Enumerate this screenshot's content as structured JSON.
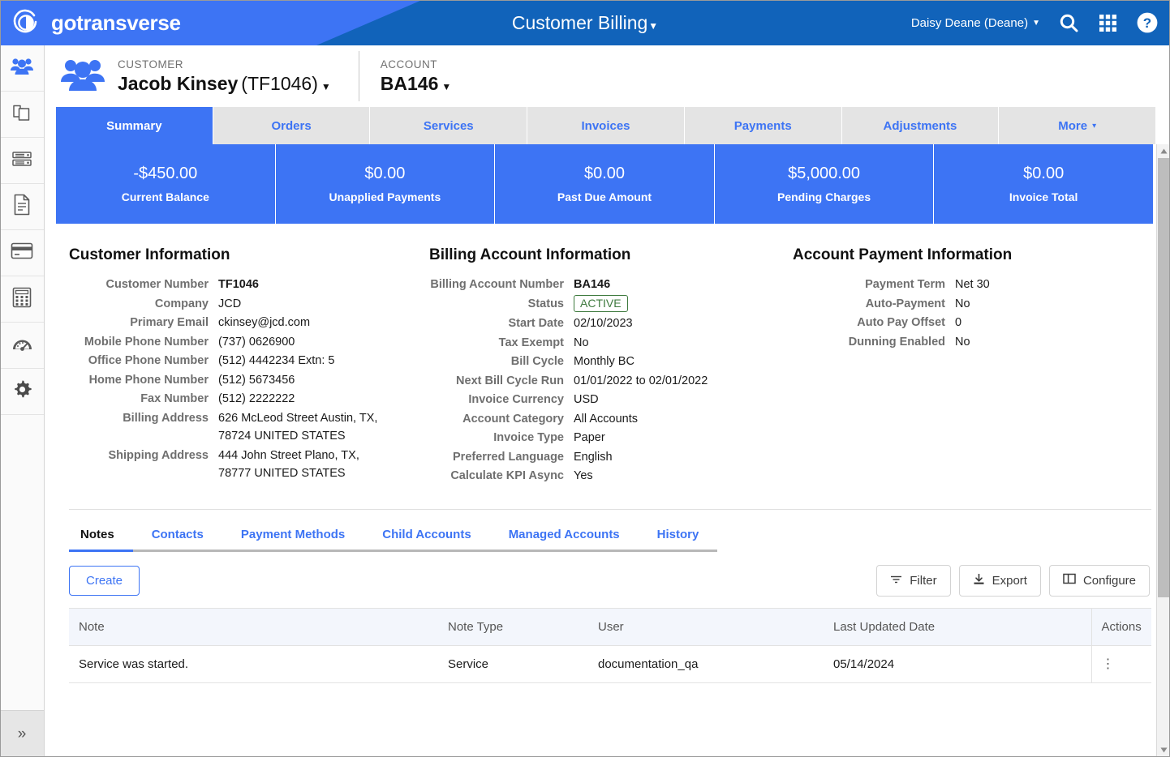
{
  "topbar": {
    "brand": "gotransverse",
    "logo_icon": "circular-arrow-logo-icon",
    "title": "Customer Billing",
    "title_caret": "▼",
    "user": "Daisy Deane (Deane)",
    "user_caret": "▼",
    "search_icon": "search-icon",
    "apps_icon": "apps-grid-icon",
    "help_icon": "help-circle-icon",
    "accent_blue": "#1163ba",
    "wedge_blue": "#3d74f4"
  },
  "rail": {
    "items": [
      {
        "icon": "customers-people-icon",
        "active": true
      },
      {
        "icon": "products-copy-icon",
        "active": false
      },
      {
        "icon": "servers-database-icon",
        "active": false
      },
      {
        "icon": "invoice-document-icon",
        "active": false
      },
      {
        "icon": "payments-credit-card-icon",
        "active": false
      },
      {
        "icon": "calculator-icon",
        "active": false
      },
      {
        "icon": "dashboard-gauge-icon",
        "active": false
      },
      {
        "icon": "settings-gear-icon",
        "active": false
      }
    ],
    "expand_icon": "»"
  },
  "context": {
    "people_icon": "customer-group-icon",
    "customer_label": "CUSTOMER",
    "customer_name": "Jacob Kinsey",
    "customer_number": "(TF1046)",
    "account_label": "ACCOUNT",
    "account_value": "BA146",
    "caret": "▼"
  },
  "tabs": [
    {
      "label": "Summary",
      "active": true
    },
    {
      "label": "Orders",
      "active": false
    },
    {
      "label": "Services",
      "active": false
    },
    {
      "label": "Invoices",
      "active": false
    },
    {
      "label": "Payments",
      "active": false
    },
    {
      "label": "Adjustments",
      "active": false
    },
    {
      "label": "More",
      "active": false,
      "caret": "▾"
    }
  ],
  "kpis": [
    {
      "value": "-$450.00",
      "label": "Current Balance"
    },
    {
      "value": "$0.00",
      "label": "Unapplied Payments"
    },
    {
      "value": "$0.00",
      "label": "Past Due Amount"
    },
    {
      "value": "$5,000.00",
      "label": "Pending Charges"
    },
    {
      "value": "$0.00",
      "label": "Invoice Total"
    }
  ],
  "customer_information": {
    "title": "Customer Information",
    "rows": [
      {
        "label": "Customer Number",
        "value": "TF1046",
        "bold": true
      },
      {
        "label": "Company",
        "value": "JCD"
      },
      {
        "label": "Primary Email",
        "value": "ckinsey@jcd.com"
      },
      {
        "label": "Mobile Phone Number",
        "value": "(737) 0626900"
      },
      {
        "label": "Office Phone Number",
        "value": "(512) 4442234 Extn: 5"
      },
      {
        "label": "Home Phone Number",
        "value": "(512) 5673456"
      },
      {
        "label": "Fax Number",
        "value": "(512) 2222222"
      },
      {
        "label": "Billing Address",
        "value": "626 McLeod Street Austin, TX, 78724 UNITED STATES"
      },
      {
        "label": "Shipping Address",
        "value": "444 John Street Plano, TX, 78777 UNITED STATES"
      }
    ]
  },
  "billing_account_information": {
    "title": "Billing Account Information",
    "rows": [
      {
        "label": "Billing Account Number",
        "value": "BA146",
        "bold": true
      },
      {
        "label": "Status",
        "value": "ACTIVE",
        "badge": true
      },
      {
        "label": "Start Date",
        "value": "02/10/2023"
      },
      {
        "label": "Tax Exempt",
        "value": "No"
      },
      {
        "label": "Bill Cycle",
        "value": "Monthly BC"
      },
      {
        "label": "Next Bill Cycle Run",
        "value": "01/01/2022 to 02/01/2022"
      },
      {
        "label": "Invoice Currency",
        "value": "USD"
      },
      {
        "label": "Account Category",
        "value": "All Accounts"
      },
      {
        "label": "Invoice Type",
        "value": "Paper"
      },
      {
        "label": "Preferred Language",
        "value": "English"
      },
      {
        "label": "Calculate KPI Async",
        "value": "Yes"
      }
    ]
  },
  "account_payment_information": {
    "title": "Account Payment Information",
    "rows": [
      {
        "label": "Payment Term",
        "value": "Net 30"
      },
      {
        "label": "Auto-Payment",
        "value": "No"
      },
      {
        "label": "Auto Pay Offset",
        "value": "0"
      },
      {
        "label": "Dunning Enabled",
        "value": "No"
      }
    ]
  },
  "subtabs": [
    {
      "label": "Notes",
      "active": true
    },
    {
      "label": "Contacts",
      "active": false
    },
    {
      "label": "Payment Methods",
      "active": false
    },
    {
      "label": "Child Accounts",
      "active": false
    },
    {
      "label": "Managed Accounts",
      "active": false
    },
    {
      "label": "History",
      "active": false
    }
  ],
  "toolbar": {
    "create_label": "Create",
    "filter_label": "Filter",
    "filter_icon": "filter-icon",
    "export_label": "Export",
    "export_icon": "download-icon",
    "configure_label": "Configure",
    "configure_icon": "columns-icon"
  },
  "notes_table": {
    "columns": [
      "Note",
      "Note Type",
      "User",
      "Last Updated Date",
      "Actions"
    ],
    "rows": [
      {
        "note": "Service was started.",
        "note_type": "Service",
        "user": "documentation_qa",
        "last_updated_date": "05/14/2024",
        "actions_icon": "kebab-menu-icon"
      }
    ]
  },
  "scrollbar": {
    "up_arrow": "▲",
    "down_arrow": "▼"
  },
  "colors": {
    "header_blue": "#1163ba",
    "primary_blue": "#3d74f4",
    "badge_green": "#3e7a3e",
    "label_gray": "#6f6f6f"
  }
}
